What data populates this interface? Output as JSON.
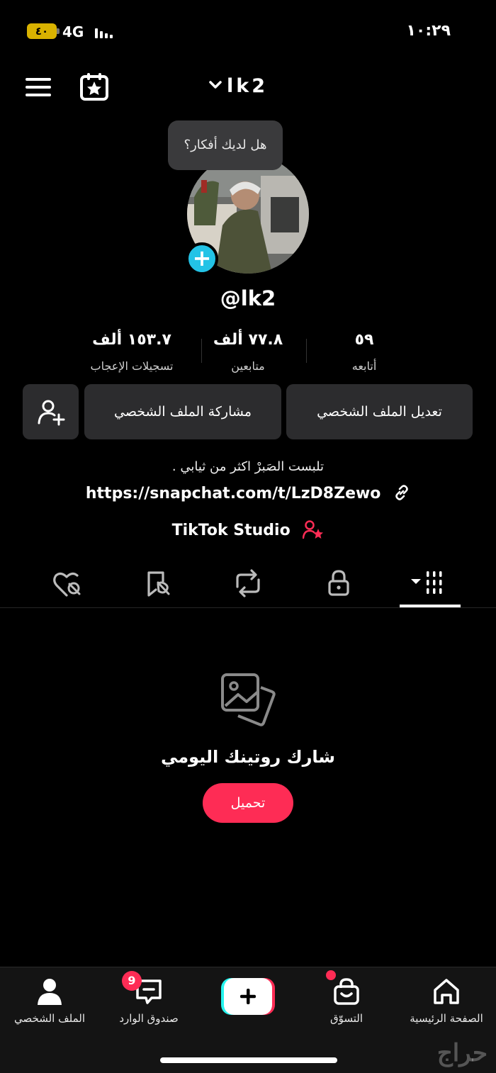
{
  "status_bar": {
    "battery": "٤٠",
    "network": "4G",
    "time": "١٠:٢٩"
  },
  "header": {
    "username": "lk2"
  },
  "profile": {
    "thought_prompt": "هل لديك أفكار؟",
    "handle": "@lk2",
    "stats": {
      "likes_value": "١٥٣.٧ ألف",
      "likes_label": "تسجيلات الإعجاب",
      "followers_value": "٧٧.٨ ألف",
      "followers_label": "متابعين",
      "following_value": "٥٩",
      "following_label": "أتابعه"
    },
    "buttons": {
      "edit_profile": "تعديل الملف الشخصي",
      "share_profile": "مشاركة الملف الشخصي"
    },
    "bio": "تلبست الصَبرْ اكثر من ثيابي .",
    "link": "https://snapchat.com/t/LzD8Zewo",
    "studio": "TikTok Studio"
  },
  "tabs": [
    {
      "icon": "videos-grid-icon",
      "active": true
    },
    {
      "icon": "lock-icon",
      "active": false
    },
    {
      "icon": "repost-icon",
      "active": false
    },
    {
      "icon": "saved-icon",
      "active": false
    },
    {
      "icon": "liked-icon",
      "active": false
    }
  ],
  "empty_state": {
    "title": "شارك روتينك اليومي",
    "upload_button": "تحميل"
  },
  "bottom_nav": {
    "home": "الصفحة الرئيسية",
    "shop": "التسوّق",
    "inbox": "صندوق الوارد",
    "inbox_badge": "9",
    "profile": "الملف الشخصي"
  },
  "watermark": "حراج",
  "colors": {
    "accent": "#fe2c55",
    "cyan": "#23c3e6",
    "button_bg": "#2c2c2e",
    "bubble_bg": "#3a3a3c"
  }
}
